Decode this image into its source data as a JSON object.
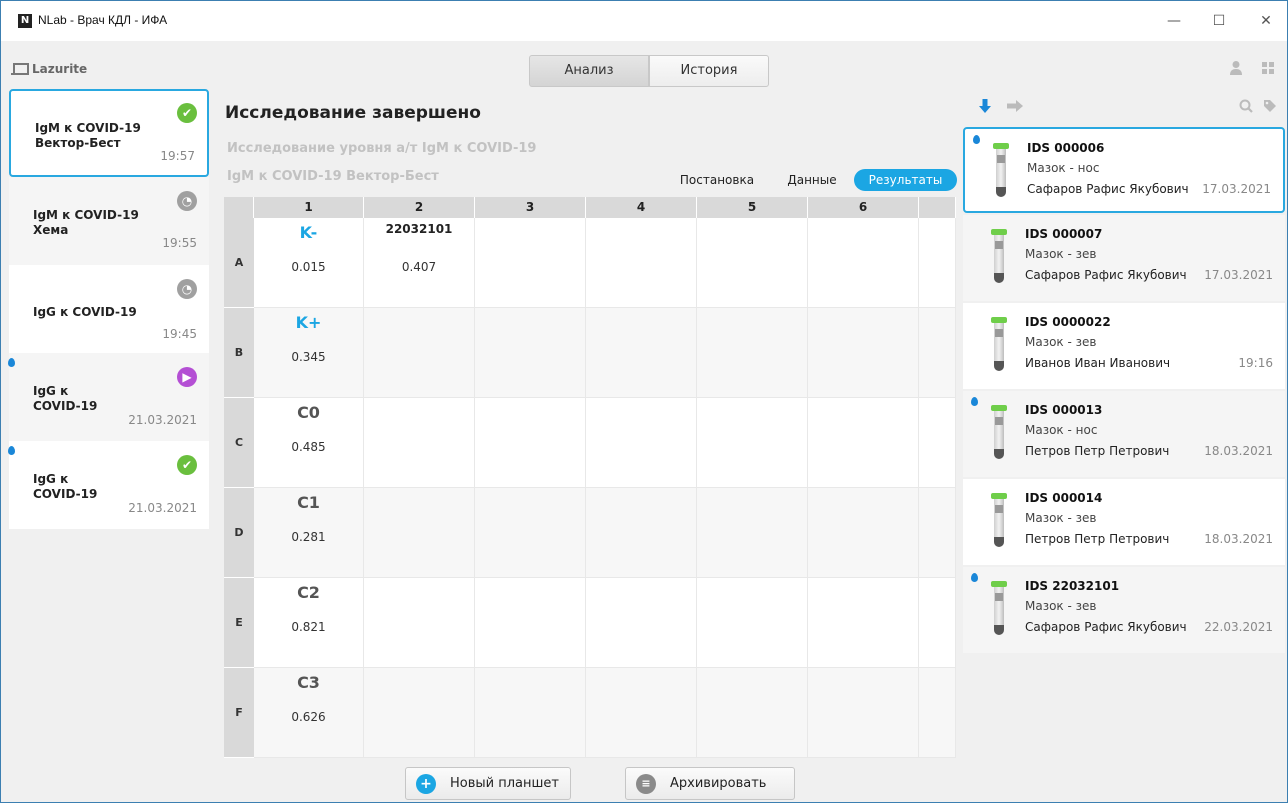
{
  "window": {
    "title": "NLab - Врач КДЛ - ИФА",
    "app_icon": "N",
    "minimize": "—",
    "maximize": "☐",
    "close": "✕"
  },
  "toolbar": {
    "brand": "Lazurite",
    "tabs": [
      "Анализ",
      "История"
    ],
    "active_tab": "Анализ"
  },
  "tests": [
    {
      "name": "IgM к COVID-19 Вектор-Бест",
      "time": "19:57",
      "status": "done",
      "drop": false,
      "selected": true
    },
    {
      "name": "IgM к COVID-19 Хема",
      "time": "19:55",
      "status": "pending",
      "drop": false,
      "selected": false
    },
    {
      "name": "IgG к COVID-19",
      "time": "19:45",
      "status": "pending",
      "drop": false,
      "selected": false
    },
    {
      "name": "IgG к COVID-19",
      "time": "21.03.2021",
      "status": "running",
      "drop": true,
      "selected": false
    },
    {
      "name": "IgG к COVID-19",
      "time": "21.03.2021",
      "status": "done",
      "drop": true,
      "selected": false
    }
  ],
  "main": {
    "title": "Исследование завершено",
    "subtitle": "Исследование уровня а/т IgM к COVID-19",
    "kit": "IgM к COVID-19 Вектор-Бест",
    "view_tabs": [
      "Постановка",
      "Данные",
      "Результаты"
    ],
    "active_view": "Результаты"
  },
  "plate": {
    "columns": [
      "1",
      "2",
      "3",
      "4",
      "5",
      "6"
    ],
    "rows": [
      "A",
      "B",
      "C",
      "D",
      "E",
      "F"
    ],
    "wells": [
      {
        "row": "A",
        "col": "1",
        "label": "K-",
        "value": "0.015",
        "kind": "control"
      },
      {
        "row": "A",
        "col": "2",
        "label": "22032101",
        "value": "0.407",
        "kind": "sample"
      },
      {
        "row": "B",
        "col": "1",
        "label": "K+",
        "value": "0.345",
        "kind": "control"
      },
      {
        "row": "C",
        "col": "1",
        "label": "C0",
        "value": "0.485",
        "kind": "standard"
      },
      {
        "row": "D",
        "col": "1",
        "label": "C1",
        "value": "0.281",
        "kind": "standard"
      },
      {
        "row": "E",
        "col": "1",
        "label": "C2",
        "value": "0.821",
        "kind": "standard"
      },
      {
        "row": "F",
        "col": "1",
        "label": "C3",
        "value": "0.626",
        "kind": "standard"
      }
    ]
  },
  "actions": {
    "new_plate": "Новый планшет",
    "archive": "Архивировать"
  },
  "samples": [
    {
      "id": "IDS 000006",
      "type": "Мазок - нос",
      "patient": "Сафаров Рафис Якубович",
      "date": "17.03.2021",
      "drop": true,
      "selected": true
    },
    {
      "id": "IDS 000007",
      "type": "Мазок - зев",
      "patient": "Сафаров Рафис Якубович",
      "date": "17.03.2021",
      "drop": false,
      "selected": false
    },
    {
      "id": "IDS 0000022",
      "type": "Мазок - зев",
      "patient": "Иванов Иван Иванович",
      "date": "19:16",
      "drop": false,
      "selected": false
    },
    {
      "id": "IDS 000013",
      "type": "Мазок - нос",
      "patient": "Петров Петр Петрович",
      "date": "18.03.2021",
      "drop": true,
      "selected": false
    },
    {
      "id": "IDS 000014",
      "type": "Мазок - зев",
      "patient": "Петров Петр Петрович",
      "date": "18.03.2021",
      "drop": false,
      "selected": false
    },
    {
      "id": "IDS 22032101",
      "type": "Мазок - зев",
      "patient": "Сафаров Рафис Якубович",
      "date": "22.03.2021",
      "drop": true,
      "selected": false
    }
  ],
  "colors": {
    "accent": "#1ba6e3",
    "done": "#6abf3e",
    "pending": "#a0a0a0",
    "running": "#b44fd4",
    "drop": "#1a87d8"
  },
  "icons": {
    "user": "user-icon",
    "apps": "grid-icon",
    "download": "download-arrow-icon",
    "forward": "forward-arrow-icon",
    "search": "search-icon",
    "tag": "tag-icon"
  }
}
